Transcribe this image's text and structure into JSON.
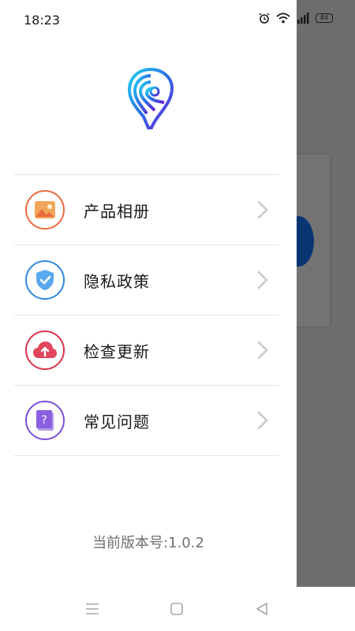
{
  "status_bar": {
    "time": "18:23",
    "battery": "84"
  },
  "drawer": {
    "menu": [
      {
        "label": "产品相册",
        "icon": "image-icon",
        "color": "#ea6b3f"
      },
      {
        "label": "隐私政策",
        "icon": "shield-check-icon",
        "color": "#2f8be0"
      },
      {
        "label": "检查更新",
        "icon": "cloud-upload-icon",
        "color": "#d8344b"
      },
      {
        "label": "常见问题",
        "icon": "help-book-icon",
        "color": "#7a4fd6"
      }
    ],
    "version_text": "当前版本号:1.0.2"
  },
  "colors": {
    "scrim": "#000000",
    "background_accent": "#1677ff"
  }
}
